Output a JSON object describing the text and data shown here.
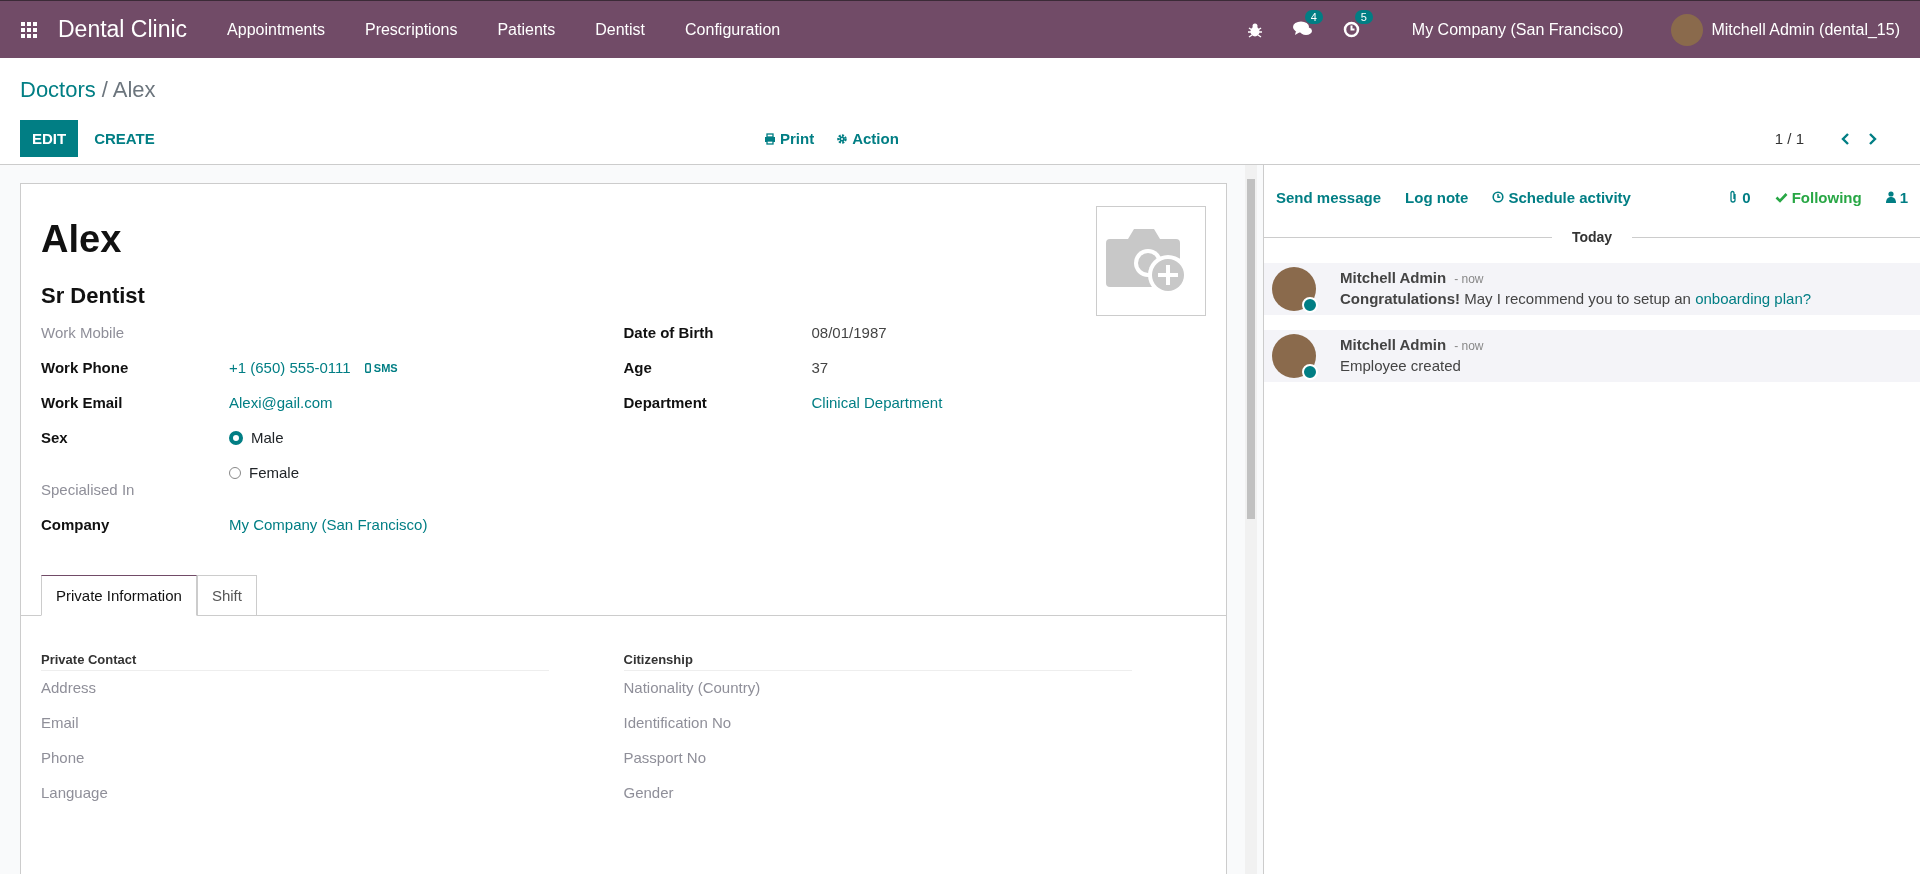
{
  "navbar": {
    "app_name": "Dental Clinic",
    "menus": [
      "Appointments",
      "Prescriptions",
      "Patients",
      "Dentist",
      "Configuration"
    ],
    "messages_badge": "4",
    "activities_badge": "5",
    "company": "My Company (San Francisco)",
    "user": "Mitchell Admin (dental_15)"
  },
  "breadcrumb": [
    {
      "label": "Doctors",
      "kind": "link"
    },
    {
      "label": "/ Alex",
      "kind": "current"
    }
  ],
  "buttons": [
    {
      "label": "EDIT",
      "kind": "primary"
    },
    {
      "label": "CREATE",
      "kind": "secondary"
    }
  ],
  "actions": [
    {
      "label": "Print",
      "kind": "print"
    },
    {
      "label": "Action",
      "kind": "gear"
    }
  ],
  "pager": "1 / 1",
  "employee": {
    "name": "Alex",
    "job_title": "Sr Dentist"
  },
  "left_fields": [
    {
      "label": "Work Mobile",
      "kind": "empty"
    },
    {
      "label": "Work Phone",
      "kind": "phone",
      "value": "+1 (650) 555-0111",
      "extra": "SMS"
    },
    {
      "label": "Work Email",
      "kind": "link",
      "value": "Alexi@gail.com"
    },
    {
      "label": "Sex",
      "kind": "radio",
      "options": [
        {
          "label": "Male",
          "selected": true
        },
        {
          "label": "Female",
          "selected": false
        }
      ]
    },
    {
      "label": "Specialised In",
      "kind": "empty"
    },
    {
      "label": "Company",
      "kind": "link",
      "value": "My Company (San Francisco)"
    }
  ],
  "right_fields": [
    {
      "label": "Date of Birth",
      "kind": "text",
      "value": "08/01/1987"
    },
    {
      "label": "Age",
      "kind": "text",
      "value": "37"
    },
    {
      "label": "Department",
      "kind": "link",
      "value": "Clinical Department"
    }
  ],
  "tabs": [
    {
      "label": "Private Information",
      "selected": true
    },
    {
      "label": "Shift",
      "selected": false
    }
  ],
  "sections": [
    {
      "title": "Private Contact",
      "fields": [
        "Address",
        "Email",
        "Phone",
        "Language"
      ]
    },
    {
      "title": "Citizenship",
      "fields": [
        "Nationality (Country)",
        "Identification No",
        "Passport No",
        "Gender"
      ]
    }
  ],
  "chatter": {
    "send_message": "Send message",
    "log_note": "Log note",
    "schedule_activity": "Schedule activity",
    "attachments": "0",
    "following": "Following",
    "followers": "1",
    "date_separator": "Today",
    "messages": [
      {
        "author": "Mitchell Admin",
        "time": "- now",
        "body": "**Congratulations!** May I recommend you to setup an",
        "link": "onboarding plan?",
        "online": true
      },
      {
        "author": "Mitchell Admin",
        "time": "- now",
        "body": "Employee created",
        "online": true
      }
    ]
  }
}
